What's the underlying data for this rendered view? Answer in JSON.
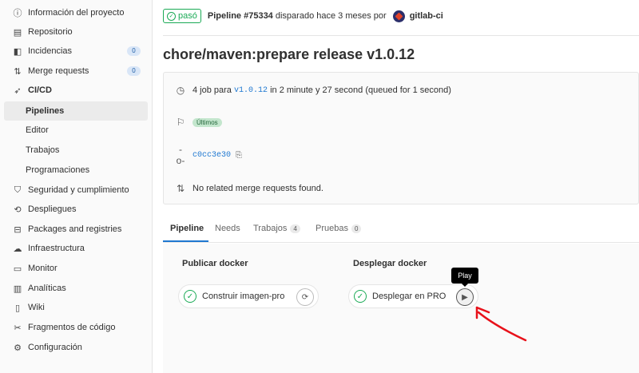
{
  "sidebar": {
    "items": [
      {
        "label": "Información del proyecto",
        "icon": "info-icon",
        "glyph": "ⓘ"
      },
      {
        "label": "Repositorio",
        "icon": "document-icon",
        "glyph": "▤"
      },
      {
        "label": "Incidencias",
        "icon": "issues-icon",
        "glyph": "◧",
        "count": "0"
      },
      {
        "label": "Merge requests",
        "icon": "merge-request-icon",
        "glyph": "⇅",
        "count": "0"
      },
      {
        "label": "CI/CD",
        "icon": "rocket-icon",
        "glyph": "➶"
      },
      {
        "label": "Pipelines",
        "sub": true,
        "active": true
      },
      {
        "label": "Editor",
        "sub": true
      },
      {
        "label": "Trabajos",
        "sub": true
      },
      {
        "label": "Programaciones",
        "sub": true
      },
      {
        "label": "Seguridad y cumplimiento",
        "icon": "shield-icon",
        "glyph": "⛉"
      },
      {
        "label": "Despliegues",
        "icon": "deployments-icon",
        "glyph": "⟲"
      },
      {
        "label": "Packages and registries",
        "icon": "package-icon",
        "glyph": "⊟"
      },
      {
        "label": "Infraestructura",
        "icon": "cloud-icon",
        "glyph": "☁"
      },
      {
        "label": "Monitor",
        "icon": "monitor-icon",
        "glyph": "▭"
      },
      {
        "label": "Analíticas",
        "icon": "chart-icon",
        "glyph": "▥"
      },
      {
        "label": "Wiki",
        "icon": "book-icon",
        "glyph": "▯"
      },
      {
        "label": "Fragmentos de código",
        "icon": "snippet-icon",
        "glyph": "✂"
      },
      {
        "label": "Configuración",
        "icon": "gear-icon",
        "glyph": "⚙"
      }
    ]
  },
  "header": {
    "status": "pasó",
    "pipeline_id": "Pipeline #75334",
    "triggered": "disparado hace 3 meses por",
    "user": "gitlab-ci"
  },
  "pipeline": {
    "title": "chore/maven:prepare release v1.0.12",
    "jobs_prefix": "4 job para",
    "ref": "v1.0.12",
    "jobs_suffix": "in 2 minute y 27 second (queued for 1 second)",
    "latest_tag": "Últimos",
    "commit": "c0cc3e30",
    "merge_requests": "No related merge requests found."
  },
  "tabs": [
    {
      "label": "Pipeline",
      "active": true
    },
    {
      "label": "Needs"
    },
    {
      "label": "Trabajos",
      "count": "4"
    },
    {
      "label": "Pruebas",
      "count": "0"
    }
  ],
  "graph": {
    "stages": [
      {
        "title": "Publicar docker",
        "job": "Construir imagen-pro",
        "action_icon": "retry-icon",
        "action_glyph": "⟳"
      },
      {
        "title": "Desplegar docker",
        "job": "Desplegar en PRO",
        "action_icon": "play-icon",
        "action_glyph": "▶"
      }
    ],
    "tooltip": "Play"
  },
  "colors": {
    "success": "#1aaa55",
    "link": "#1f78d1",
    "annotation_arrow": "#e8111a"
  }
}
